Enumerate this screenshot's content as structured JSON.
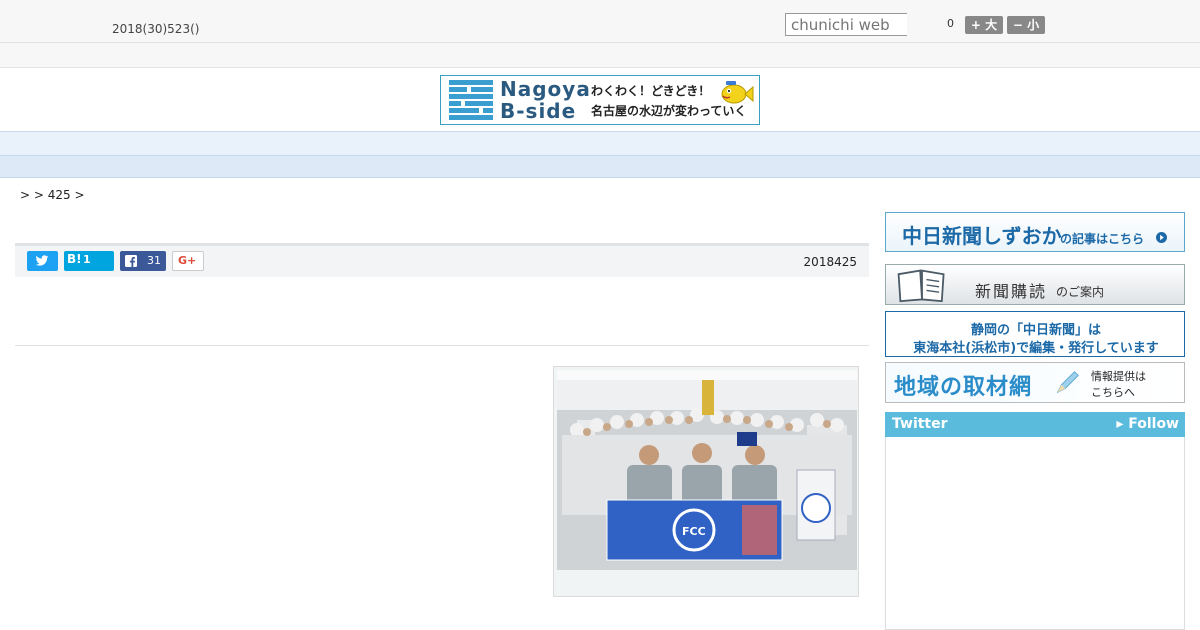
{
  "header": {
    "date": "2018(30)523()",
    "search_placeholder": "chunichi web",
    "font_size_count": "0",
    "font_bigger": "+ 大",
    "font_smaller": "− 小"
  },
  "banner": {
    "title_line1": "Nagoya",
    "title_line2": "B-side",
    "tagline1": "わくわく！どきどき！",
    "tagline2": "名古屋の水辺が変わっていく",
    "icon_left": "building-grid-icon",
    "icon_right": "fish-mascot-icon"
  },
  "nav": {
    "items": [
      "",
      "",
      "",
      "",
      "",
      "",
      "",
      "",
      ""
    ]
  },
  "breadcrumb": {
    "text": ">  > 425 >"
  },
  "share": {
    "twitter_icon": "twitter-bird-icon",
    "hatena_label": "B!",
    "hatena_count": "1",
    "facebook_count": "31",
    "gplus_label": "G+",
    "published_date": "2018425"
  },
  "article": {
    "photo_icon": "group-photo-icon"
  },
  "sidebar": {
    "shizuoka_title": "中日新聞しずおか",
    "shizuoka_link": "の記事はこちら",
    "subscribe_title": "新聞購読",
    "subscribe_suffix": "のご案内",
    "hq_line1": "静岡の「中日新聞」は",
    "hq_line2": "東海本社(浜松市)で編集・発行しています",
    "network_title": "地域の取材網",
    "network_tip1": "情報提供は",
    "network_tip2": "こちらへ",
    "twitter_title": "Twitter",
    "twitter_follow": "▸ Follow"
  },
  "colors": {
    "accent_blue": "#1c69a8",
    "nav_bg": "#e9f1fa",
    "twitter_head": "#5bbbdd",
    "facebook": "#3b5998",
    "twitter": "#1da1f2"
  }
}
